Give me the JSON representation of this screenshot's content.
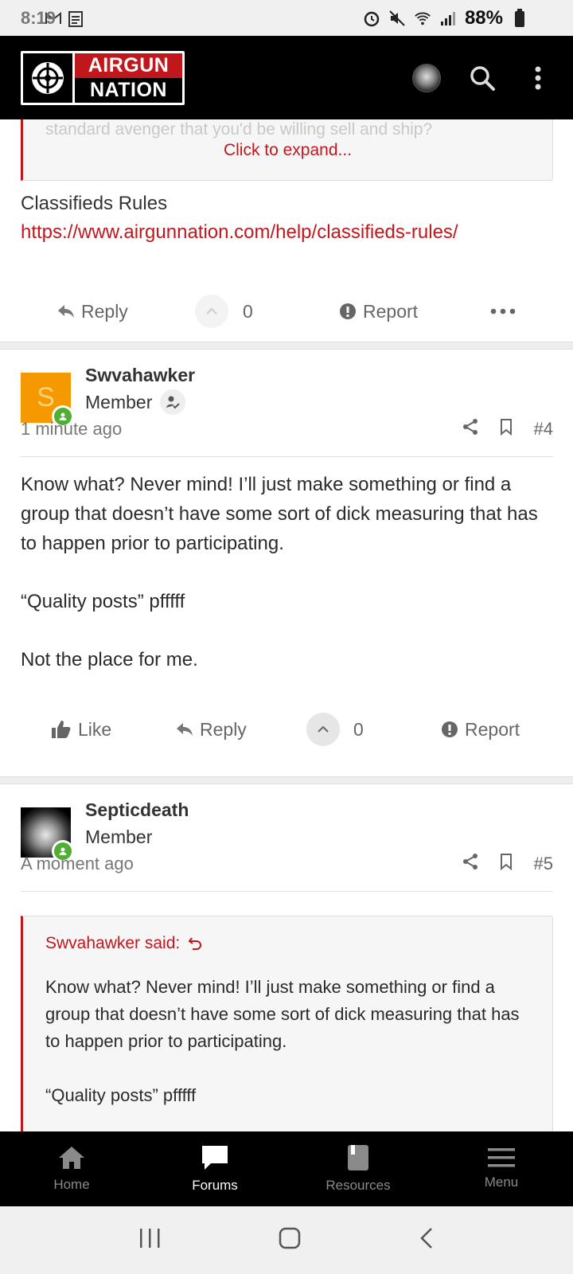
{
  "status": {
    "time": "8:19",
    "battery": "88%"
  },
  "header": {
    "logo_top": "AIRGUN",
    "logo_bottom": "NATION"
  },
  "prev_post": {
    "quote_faded": "standard avenger that you'd be willing sell and ship?",
    "expand_label": "Click to expand...",
    "rules_title": "Classifieds Rules",
    "rules_link": "https://www.airgunnation.com/help/classifieds-rules/",
    "reply_label": "Reply",
    "vote_count": "0",
    "report_label": "Report"
  },
  "post4": {
    "avatar_letter": "S",
    "username": "Swvahawker",
    "user_title": "Member",
    "time": "1 minute ago",
    "post_number": "#4",
    "body": [
      "Know what? Never mind! I’ll just make something or find a group that doesn’t have some sort of dick measuring that has to happen prior to participating.",
      "“Quality posts” pfffff",
      "Not the place for me."
    ],
    "like_label": "Like",
    "reply_label": "Reply",
    "vote_count": "0",
    "report_label": "Report"
  },
  "post5": {
    "username": "Septicdeath",
    "user_title": "Member",
    "time": "A moment ago",
    "post_number": "#5",
    "quote_attrib": "Swvahawker said:",
    "quote_body": [
      "Know what? Never mind! I’ll just make something or find a group that doesn’t have some sort of dick measuring that has to happen prior to participating.",
      "“Quality posts” pfffff"
    ]
  },
  "bottom_nav": [
    {
      "label": "Home",
      "icon": "home-icon",
      "active": false
    },
    {
      "label": "Forums",
      "icon": "chat-icon",
      "active": true
    },
    {
      "label": "Resources",
      "icon": "book-icon",
      "active": false
    },
    {
      "label": "Menu",
      "icon": "hamburger-icon",
      "active": false
    }
  ],
  "colors": {
    "brand_red": "#c0171c",
    "online_green": "#4fae33",
    "avatar_orange": "#f49a00"
  }
}
